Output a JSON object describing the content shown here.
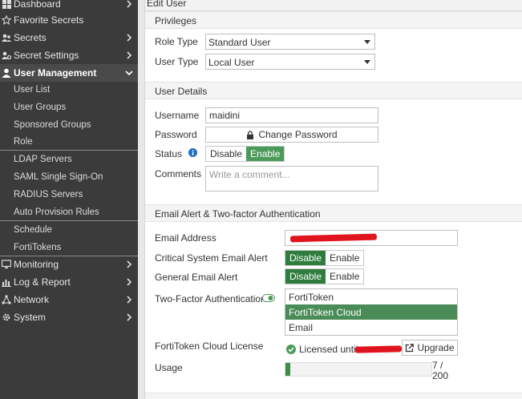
{
  "sidebar": {
    "items": [
      {
        "label": "Dashboard",
        "icon": "dashboard-icon",
        "chevron": "right"
      },
      {
        "label": "Favorite Secrets",
        "icon": "star-icon",
        "chevron": ""
      },
      {
        "label": "Secrets",
        "icon": "users-icon",
        "chevron": "right"
      },
      {
        "label": "Secret Settings",
        "icon": "users-gear-icon",
        "chevron": "right"
      },
      {
        "label": "User Management",
        "icon": "user-icon",
        "chevron": "down",
        "active": true
      }
    ],
    "sub_items": [
      "User List",
      "User Groups",
      "Sponsored Groups",
      "Role",
      "LDAP Servers",
      "SAML Single Sign-On",
      "RADIUS Servers",
      "Auto Provision Rules",
      "Schedule",
      "FortiTokens"
    ],
    "bottom_items": [
      {
        "label": "Monitoring",
        "icon": "monitor-icon"
      },
      {
        "label": "Log & Report",
        "icon": "bar-chart-icon"
      },
      {
        "label": "Network",
        "icon": "network-icon"
      },
      {
        "label": "System",
        "icon": "gear-icon"
      }
    ]
  },
  "page": {
    "title": "Edit User"
  },
  "privileges": {
    "heading": "Privileges",
    "role_type_label": "Role Type",
    "role_type_value": "Standard User",
    "user_type_label": "User Type",
    "user_type_value": "Local User"
  },
  "user_details": {
    "heading": "User Details",
    "username_label": "Username",
    "username_value": "maidini",
    "password_label": "Password",
    "change_password": "Change Password",
    "status_label": "Status",
    "status_disable": "Disable",
    "status_enable": "Enable",
    "comments_label": "Comments",
    "comments_placeholder": "Write a comment..."
  },
  "email_alert": {
    "heading": "Email Alert & Two-factor Authentication",
    "email_label": "Email Address",
    "critical_label": "Critical System Email Alert",
    "general_label": "General Email Alert",
    "disable": "Disable",
    "enable": "Enable",
    "two_factor_label": "Two-Factor Authentication",
    "two_factor_options": [
      "FortiToken",
      "FortiToken Cloud",
      "Email"
    ],
    "two_factor_selected": "FortiToken Cloud",
    "license_label": "FortiToken Cloud License",
    "license_text": "Licensed until",
    "upgrade": "Upgrade",
    "usage_label": "Usage",
    "usage_count": "7 /",
    "usage_total": "200",
    "usage_fraction": 0.035
  },
  "colors": {
    "accent": "#4c9a5a",
    "sidebar_bg": "#3b3b3b",
    "redaction": "#e0141e"
  }
}
